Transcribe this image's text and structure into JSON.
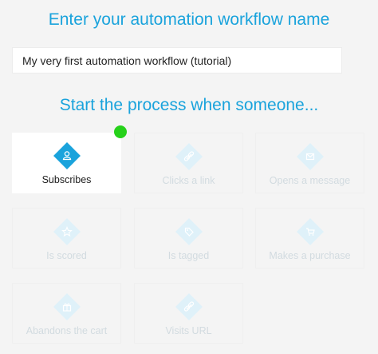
{
  "title": "Enter your automation workflow name",
  "workflow_name": {
    "value": "My very first automation workflow (tutorial)"
  },
  "trigger_heading": "Start the process when someone...",
  "triggers": [
    {
      "label": "Subscribes",
      "icon": "person-icon",
      "selected": true
    },
    {
      "label": "Clicks a link",
      "icon": "link-icon",
      "selected": false
    },
    {
      "label": "Opens a message",
      "icon": "envelope-icon",
      "selected": false
    },
    {
      "label": "Is scored",
      "icon": "star-icon",
      "selected": false
    },
    {
      "label": "Is tagged",
      "icon": "tag-icon",
      "selected": false
    },
    {
      "label": "Makes a purchase",
      "icon": "cart-icon",
      "selected": false
    },
    {
      "label": "Abandons the cart",
      "icon": "gift-icon",
      "selected": false
    },
    {
      "label": "Visits URL",
      "icon": "url-link-icon",
      "selected": false
    }
  ],
  "colors": {
    "accent": "#1aa3dc",
    "status_dot": "#26d11a",
    "inactive_icon": "#dff1f9",
    "background": "#f4f4f4"
  }
}
